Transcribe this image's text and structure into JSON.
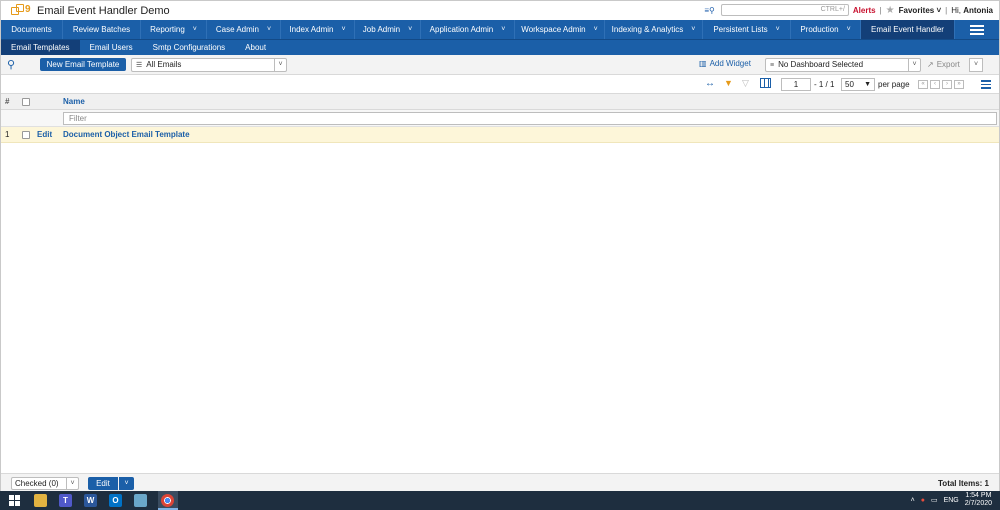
{
  "header": {
    "app_title": "Email Event Handler Demo",
    "search_placeholder": "CTRL+/",
    "alerts_label": "Alerts",
    "favorites_label": "Favorites",
    "greeting_prefix": "Hi,",
    "user_name": "Antonia"
  },
  "nav": {
    "items": [
      {
        "label": "Documents"
      },
      {
        "label": "Review Batches"
      },
      {
        "label": "Reporting"
      },
      {
        "label": "Case Admin"
      },
      {
        "label": "Index Admin"
      },
      {
        "label": "Job Admin"
      },
      {
        "label": "Application Admin"
      },
      {
        "label": "Workspace Admin"
      },
      {
        "label": "Indexing & Analytics"
      },
      {
        "label": "Persistent Lists"
      },
      {
        "label": "Production"
      },
      {
        "label": "Email Event Handler"
      }
    ]
  },
  "subnav": {
    "items": [
      {
        "label": "Email Templates"
      },
      {
        "label": "Email Users"
      },
      {
        "label": "Smtp Configurations"
      },
      {
        "label": "About"
      }
    ]
  },
  "toolbar": {
    "new_button": "New Email Template",
    "view_selected": "All Emails",
    "add_widget": "Add Widget",
    "dashboard_selected": "No Dashboard Selected",
    "export_label": "Export"
  },
  "grid": {
    "page_current": "1",
    "page_of": "- 1 / 1",
    "per_page_value": "50",
    "per_page_label": "per page",
    "columns": {
      "num": "#",
      "name": "Name"
    },
    "filter_placeholder": "Filter",
    "rows": [
      {
        "num": "1",
        "edit": "Edit",
        "name": "Document Object Email Template"
      }
    ]
  },
  "footer": {
    "checked_label": "Checked (0)",
    "edit_button": "Edit",
    "total_items": "Total Items: 1"
  },
  "taskbar": {
    "lang": "ENG",
    "time": "1:54 PM",
    "date": "2/7/2020"
  }
}
